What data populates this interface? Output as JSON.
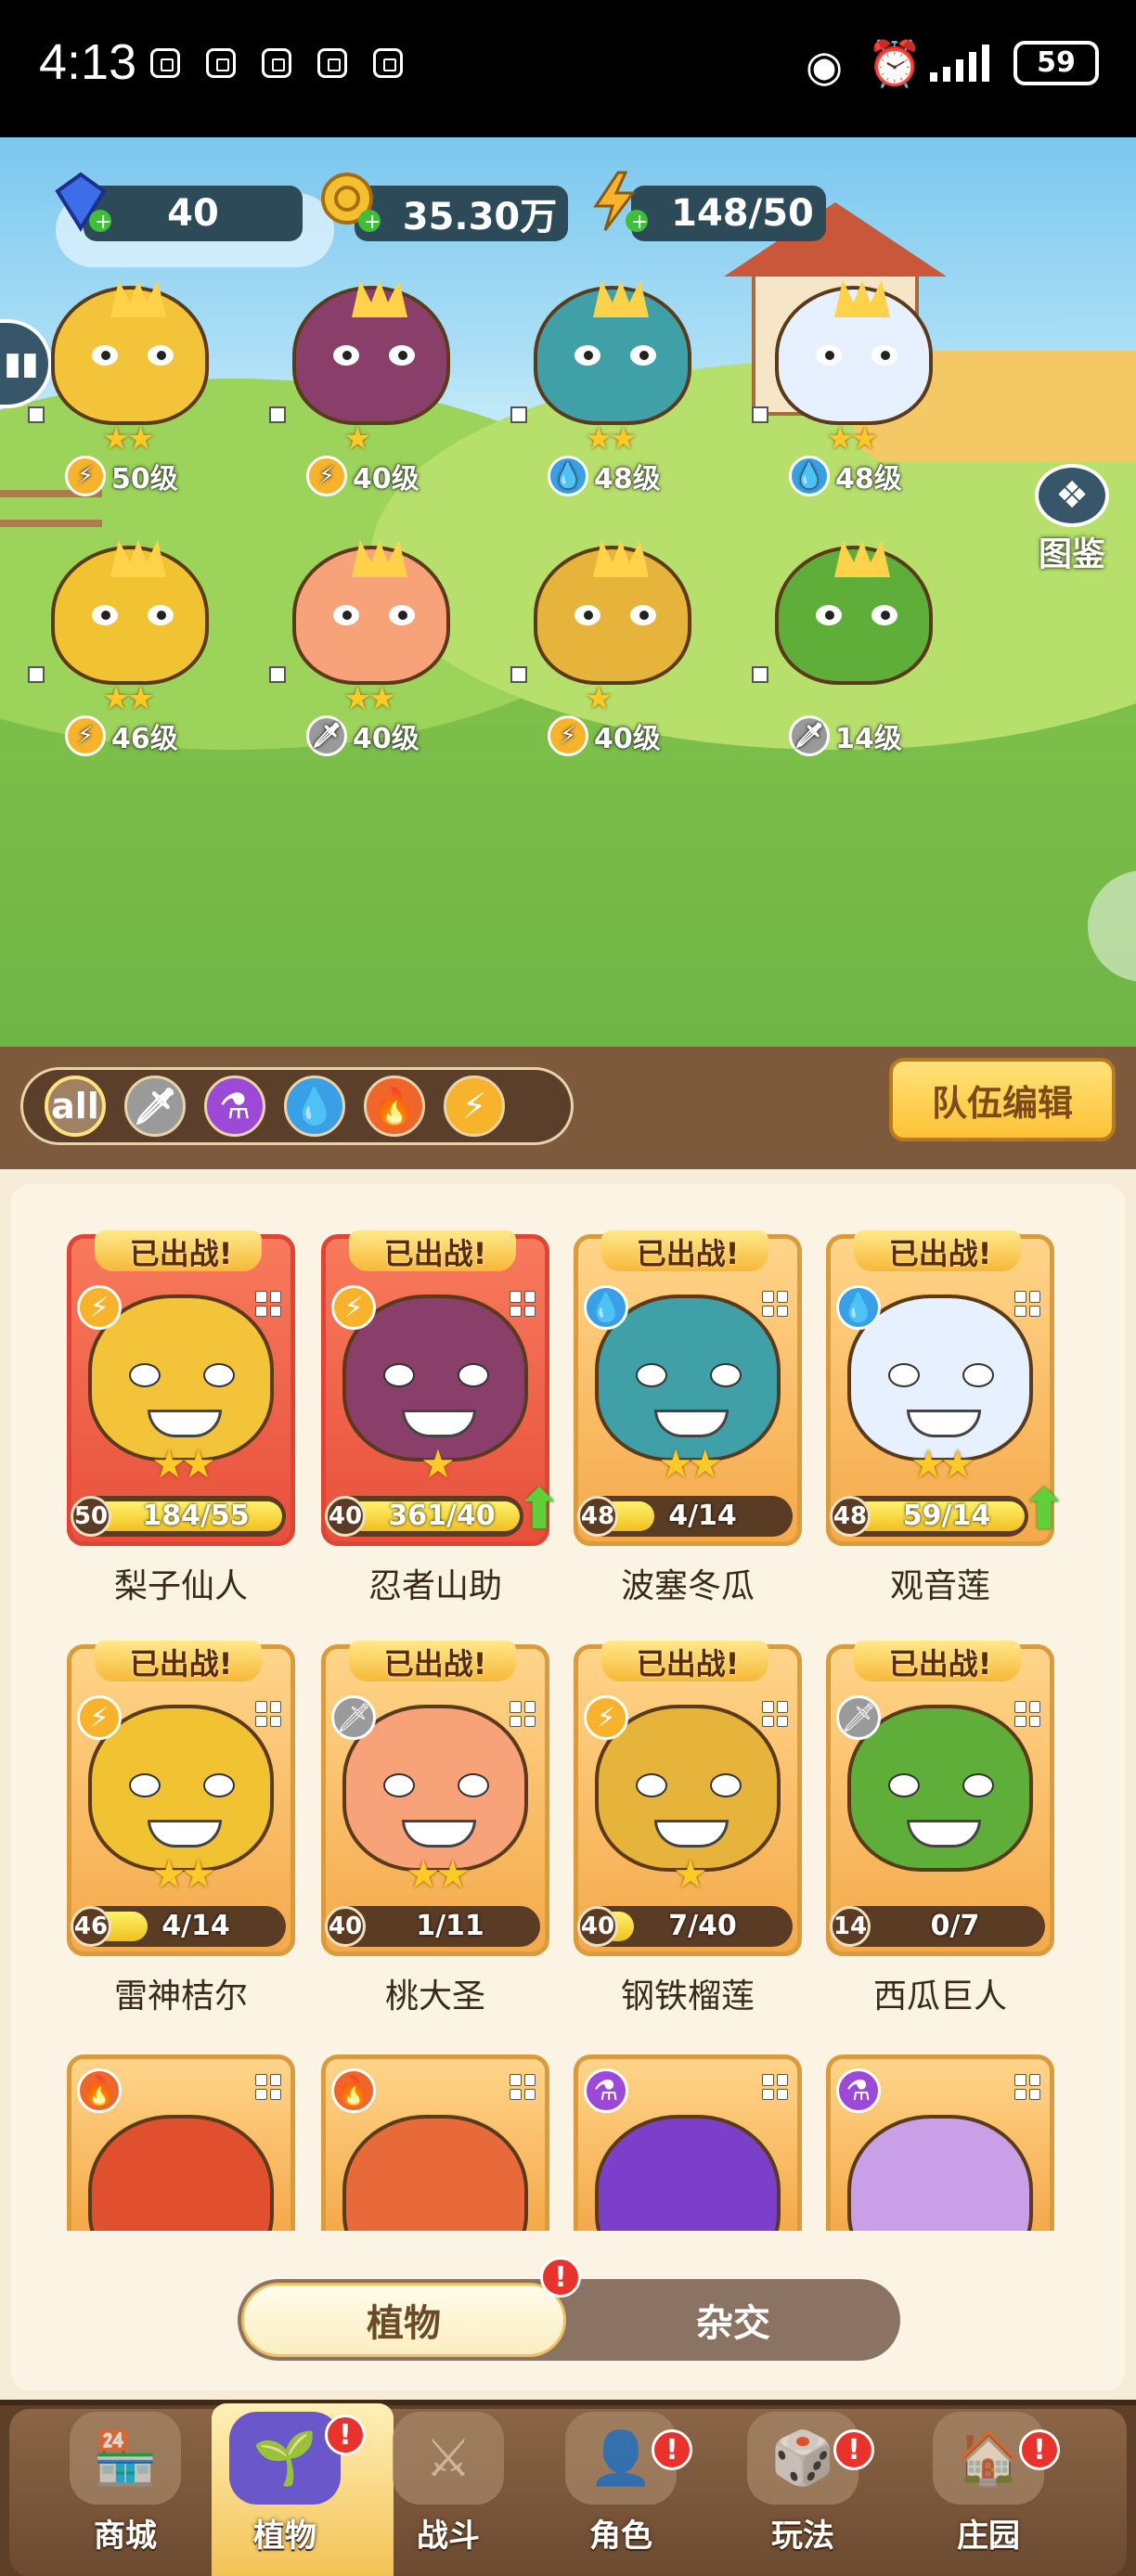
{
  "status_bar": {
    "time": "4:13",
    "battery": "59"
  },
  "resources": {
    "gems": "40",
    "coins": "35.30万",
    "energy": "148/50"
  },
  "side_buttons": {
    "codex": "图鉴"
  },
  "lineup": [
    {
      "name": "梨子仙人",
      "element": "lightning",
      "stars": 2,
      "level_label": "50级"
    },
    {
      "name": "忍者山助",
      "element": "lightning",
      "stars": 1,
      "level_label": "40级"
    },
    {
      "name": "波塞冬瓜",
      "element": "water",
      "stars": 2,
      "level_label": "48级"
    },
    {
      "name": "观音莲",
      "element": "water",
      "stars": 2,
      "level_label": "48级"
    },
    {
      "name": "雷神桔尔",
      "element": "lightning",
      "stars": 2,
      "level_label": "46级"
    },
    {
      "name": "桃大圣",
      "element": "sword",
      "stars": 2,
      "level_label": "40级"
    },
    {
      "name": "钢铁榴莲",
      "element": "lightning",
      "stars": 1,
      "level_label": "40级"
    },
    {
      "name": "西瓜巨人",
      "element": "sword",
      "stars": 0,
      "level_label": "14级"
    }
  ],
  "filters": [
    {
      "id": "all",
      "label": "all"
    },
    {
      "id": "sword",
      "icon": "sword-icon"
    },
    {
      "id": "poison",
      "icon": "potion-icon"
    },
    {
      "id": "water",
      "icon": "water-drop-icon"
    },
    {
      "id": "fire",
      "icon": "flame-icon"
    },
    {
      "id": "lightning",
      "icon": "lightning-icon"
    }
  ],
  "team_edit_label": "队伍编辑",
  "deployed_label": "已出战!",
  "cards": [
    {
      "name": "梨子仙人",
      "level": "50",
      "progress": "184/55",
      "fill": 1.0,
      "stars": 2,
      "element": "lightning",
      "theme": "red",
      "upgrade": false
    },
    {
      "name": "忍者山助",
      "level": "40",
      "progress": "361/40",
      "fill": 1.0,
      "stars": 1,
      "element": "lightning",
      "theme": "red",
      "upgrade": true
    },
    {
      "name": "波塞冬瓜",
      "level": "48",
      "progress": "4/14",
      "fill": 0.29,
      "stars": 2,
      "element": "water",
      "theme": "gold",
      "upgrade": false
    },
    {
      "name": "观音莲",
      "level": "48",
      "progress": "59/14",
      "fill": 1.0,
      "stars": 2,
      "element": "water",
      "theme": "gold",
      "upgrade": true
    },
    {
      "name": "雷神桔尔",
      "level": "46",
      "progress": "4/14",
      "fill": 0.29,
      "stars": 2,
      "element": "lightning",
      "theme": "gold",
      "upgrade": false
    },
    {
      "name": "桃大圣",
      "level": "40",
      "progress": "1/11",
      "fill": 0.09,
      "stars": 2,
      "element": "sword",
      "theme": "gold",
      "upgrade": false
    },
    {
      "name": "钢铁榴莲",
      "level": "40",
      "progress": "7/40",
      "fill": 0.18,
      "stars": 1,
      "element": "lightning",
      "theme": "gold",
      "upgrade": false
    },
    {
      "name": "西瓜巨人",
      "level": "14",
      "progress": "0/7",
      "fill": 0.0,
      "stars": 0,
      "element": "sword",
      "theme": "gold",
      "upgrade": false
    }
  ],
  "partial_cards": [
    {
      "element": "fire"
    },
    {
      "element": "fire"
    },
    {
      "element": "poison"
    },
    {
      "element": "poison"
    }
  ],
  "toggle": {
    "left": "植物",
    "right": "杂交",
    "alert": "!"
  },
  "nav": [
    {
      "label": "商城",
      "icon": "shop-icon",
      "badge": false
    },
    {
      "label": "植物",
      "icon": "plants-icon",
      "badge": true,
      "active": true
    },
    {
      "label": "战斗",
      "icon": "battle-icon",
      "badge": false
    },
    {
      "label": "角色",
      "icon": "character-icon",
      "badge": true
    },
    {
      "label": "玩法",
      "icon": "gameplay-icon",
      "badge": true
    },
    {
      "label": "庄园",
      "icon": "manor-icon",
      "badge": true
    }
  ],
  "colors": {
    "lightning": "#f7b32b",
    "water": "#3aa0e6",
    "sword": "#9a9a9a",
    "fire": "#f0662a",
    "poison": "#9b49d6"
  }
}
